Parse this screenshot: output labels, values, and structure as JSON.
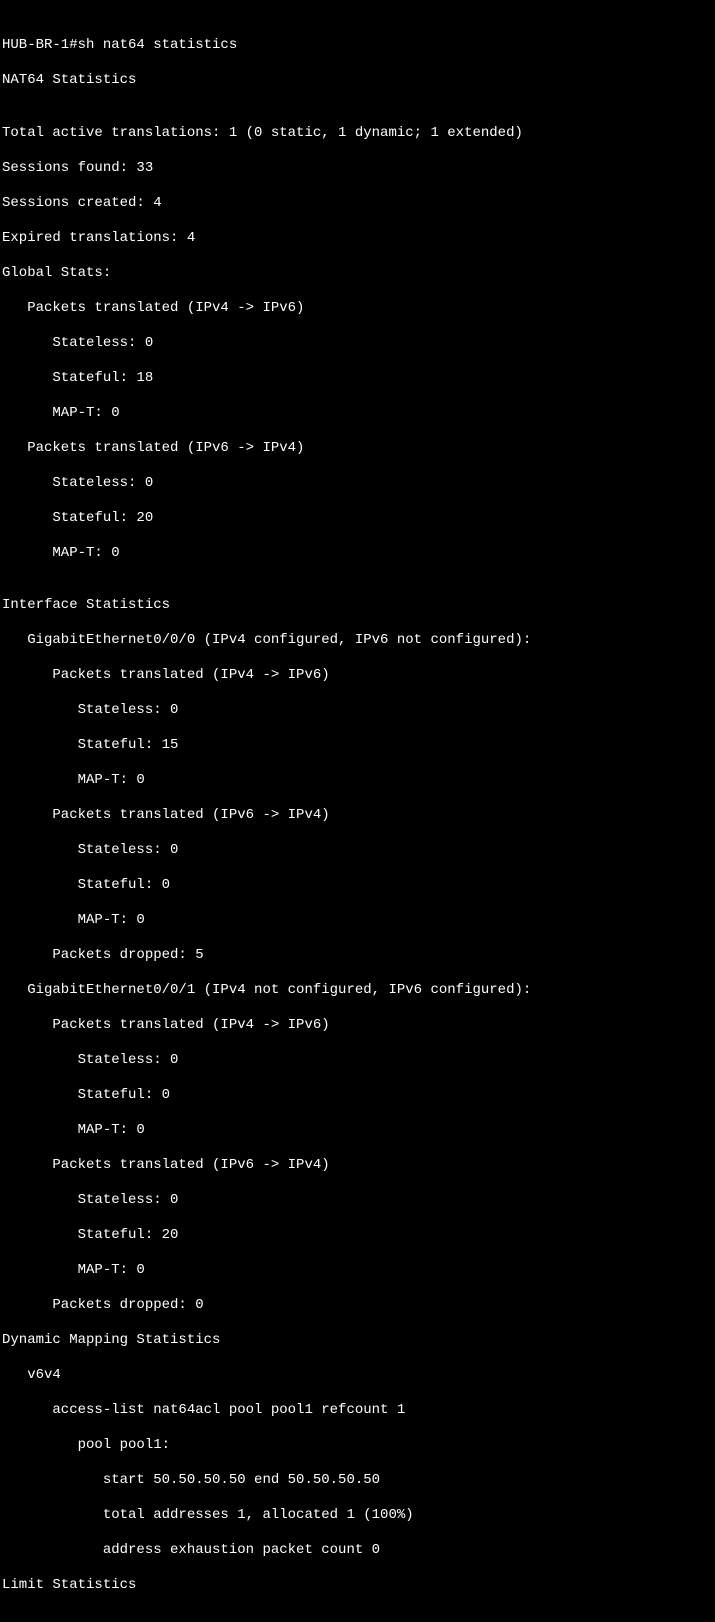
{
  "prompt": "HUB-BR-1#sh nat64 statistics",
  "title": "NAT64 Statistics",
  "blank": "",
  "summary": {
    "total_active": "Total active translations: 1 (0 static, 1 dynamic; 1 extended)",
    "sessions_found": "Sessions found: 33",
    "sessions_created": "Sessions created: 4",
    "expired": "Expired translations: 4"
  },
  "global": {
    "header": "Global Stats:",
    "v4v6_header": "   Packets translated (IPv4 -> IPv6)",
    "v4v6_stateless": "      Stateless: 0",
    "v4v6_stateful": "      Stateful: 18",
    "v4v6_mapt": "      MAP-T: 0",
    "v6v4_header": "   Packets translated (IPv6 -> IPv4)",
    "v6v4_stateless": "      Stateless: 0",
    "v6v4_stateful": "      Stateful: 20",
    "v6v4_mapt": "      MAP-T: 0"
  },
  "iface": {
    "header": "Interface Statistics",
    "g000": {
      "name": "   GigabitEthernet0/0/0 (IPv4 configured, IPv6 not configured):",
      "v4v6_header": "      Packets translated (IPv4 -> IPv6)",
      "v4v6_stateless": "         Stateless: 0",
      "v4v6_stateful": "         Stateful: 15",
      "v4v6_mapt": "         MAP-T: 0",
      "v6v4_header": "      Packets translated (IPv6 -> IPv4)",
      "v6v4_stateless": "         Stateless: 0",
      "v6v4_stateful": "         Stateful: 0",
      "v6v4_mapt": "         MAP-T: 0",
      "dropped": "      Packets dropped: 5"
    },
    "g001": {
      "name": "   GigabitEthernet0/0/1 (IPv4 not configured, IPv6 configured):",
      "v4v6_header": "      Packets translated (IPv4 -> IPv6)",
      "v4v6_stateless": "         Stateless: 0",
      "v4v6_stateful": "         Stateful: 0",
      "v4v6_mapt": "         MAP-T: 0",
      "v6v4_header": "      Packets translated (IPv6 -> IPv4)",
      "v6v4_stateless": "         Stateless: 0",
      "v6v4_stateful": "         Stateful: 20",
      "v6v4_mapt": "         MAP-T: 0",
      "dropped": "      Packets dropped: 0"
    }
  },
  "dynmap": {
    "header": "Dynamic Mapping Statistics",
    "v6v4": "   v6v4",
    "acl": "      access-list nat64acl pool pool1 refcount 1",
    "poolname": "         pool pool1:",
    "range": "            start 50.50.50.50 end 50.50.50.50",
    "total": "            total addresses 1, allocated 1 (100%)",
    "exhaust": "            address exhaustion packet count 0"
  },
  "limit": "Limit Statistics"
}
